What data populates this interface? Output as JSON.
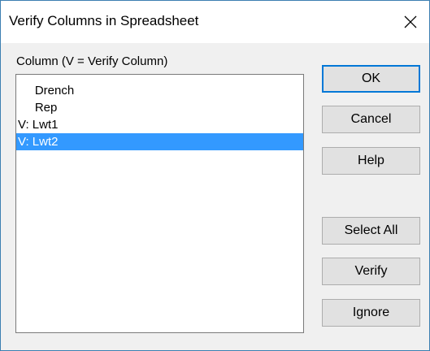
{
  "window": {
    "title": "Verify Columns in Spreadsheet",
    "close_icon": "close-x-icon"
  },
  "list": {
    "label": "Column (V = Verify Column)",
    "items": [
      {
        "label": "     Drench",
        "selected": false
      },
      {
        "label": "     Rep",
        "selected": false
      },
      {
        "label": "V: Lwt1",
        "selected": false
      },
      {
        "label": "V: Lwt2",
        "selected": true
      }
    ]
  },
  "buttons": {
    "ok": "OK",
    "cancel": "Cancel",
    "help": "Help",
    "select_all": "Select All",
    "verify": "Verify",
    "ignore": "Ignore"
  },
  "colors": {
    "selection": "#3399ff",
    "default_button_border": "#0078d7",
    "window_border": "#3c7fb1"
  }
}
